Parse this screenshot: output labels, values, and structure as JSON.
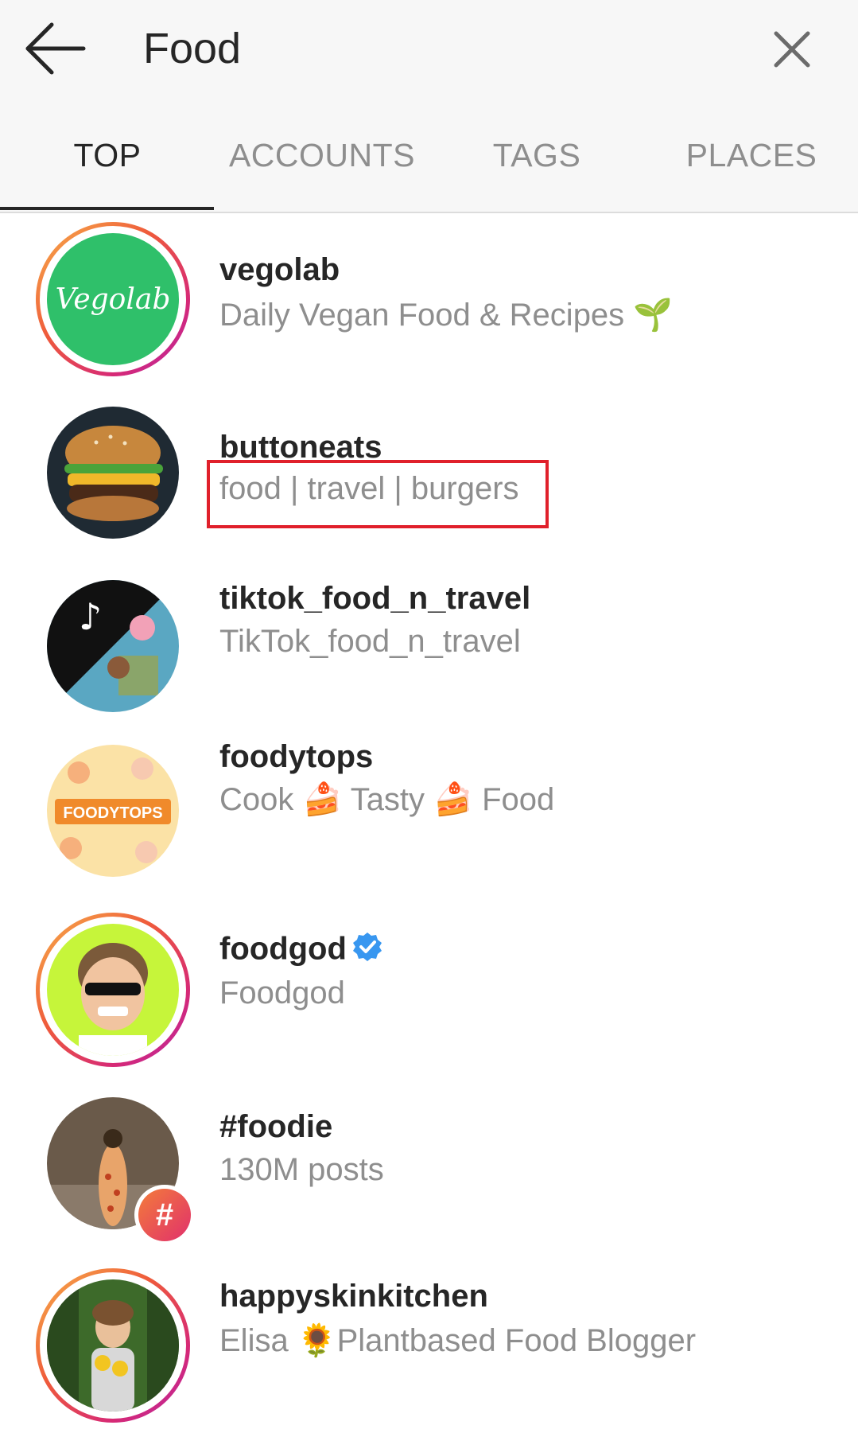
{
  "search": {
    "query": "Food"
  },
  "tabs": [
    {
      "label": "TOP"
    },
    {
      "label": "ACCOUNTS"
    },
    {
      "label": "TAGS"
    },
    {
      "label": "PLACES"
    }
  ],
  "results": [
    {
      "title": "vegolab",
      "subtitle": "Daily Vegan Food & Recipes 🌱",
      "avatar_text": "Vegolab"
    },
    {
      "title": "buttoneats",
      "subtitle": "food | travel | burgers"
    },
    {
      "title": "tiktok_food_n_travel",
      "subtitle": "TikTok_food_n_travel"
    },
    {
      "title": "foodytops",
      "subtitle": "Cook 🍰 Tasty 🍰 Food",
      "avatar_text": "FOODYTOPS"
    },
    {
      "title": "foodgod",
      "subtitle": "Foodgod"
    },
    {
      "title": "#foodie",
      "subtitle": "130M posts",
      "badge": "#"
    },
    {
      "title": "happyskinkitchen",
      "subtitle": "Elisa 🌻Plantbased Food Blogger"
    }
  ],
  "colors": {
    "accent_ring_start": "#f7b24a",
    "accent_ring_end": "#b525a6",
    "highlight_box": "#e0202b",
    "verified": "#3897f0"
  }
}
